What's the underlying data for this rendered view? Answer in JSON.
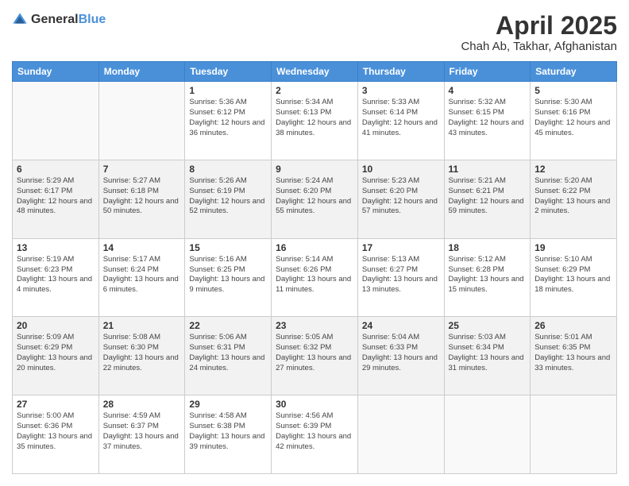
{
  "header": {
    "logo_general": "General",
    "logo_blue": "Blue",
    "month": "April 2025",
    "location": "Chah Ab, Takhar, Afghanistan"
  },
  "days_of_week": [
    "Sunday",
    "Monday",
    "Tuesday",
    "Wednesday",
    "Thursday",
    "Friday",
    "Saturday"
  ],
  "weeks": [
    [
      {
        "day": "",
        "info": ""
      },
      {
        "day": "",
        "info": ""
      },
      {
        "day": "1",
        "info": "Sunrise: 5:36 AM\nSunset: 6:12 PM\nDaylight: 12 hours\nand 36 minutes."
      },
      {
        "day": "2",
        "info": "Sunrise: 5:34 AM\nSunset: 6:13 PM\nDaylight: 12 hours\nand 38 minutes."
      },
      {
        "day": "3",
        "info": "Sunrise: 5:33 AM\nSunset: 6:14 PM\nDaylight: 12 hours\nand 41 minutes."
      },
      {
        "day": "4",
        "info": "Sunrise: 5:32 AM\nSunset: 6:15 PM\nDaylight: 12 hours\nand 43 minutes."
      },
      {
        "day": "5",
        "info": "Sunrise: 5:30 AM\nSunset: 6:16 PM\nDaylight: 12 hours\nand 45 minutes."
      }
    ],
    [
      {
        "day": "6",
        "info": "Sunrise: 5:29 AM\nSunset: 6:17 PM\nDaylight: 12 hours\nand 48 minutes."
      },
      {
        "day": "7",
        "info": "Sunrise: 5:27 AM\nSunset: 6:18 PM\nDaylight: 12 hours\nand 50 minutes."
      },
      {
        "day": "8",
        "info": "Sunrise: 5:26 AM\nSunset: 6:19 PM\nDaylight: 12 hours\nand 52 minutes."
      },
      {
        "day": "9",
        "info": "Sunrise: 5:24 AM\nSunset: 6:20 PM\nDaylight: 12 hours\nand 55 minutes."
      },
      {
        "day": "10",
        "info": "Sunrise: 5:23 AM\nSunset: 6:20 PM\nDaylight: 12 hours\nand 57 minutes."
      },
      {
        "day": "11",
        "info": "Sunrise: 5:21 AM\nSunset: 6:21 PM\nDaylight: 12 hours\nand 59 minutes."
      },
      {
        "day": "12",
        "info": "Sunrise: 5:20 AM\nSunset: 6:22 PM\nDaylight: 13 hours\nand 2 minutes."
      }
    ],
    [
      {
        "day": "13",
        "info": "Sunrise: 5:19 AM\nSunset: 6:23 PM\nDaylight: 13 hours\nand 4 minutes."
      },
      {
        "day": "14",
        "info": "Sunrise: 5:17 AM\nSunset: 6:24 PM\nDaylight: 13 hours\nand 6 minutes."
      },
      {
        "day": "15",
        "info": "Sunrise: 5:16 AM\nSunset: 6:25 PM\nDaylight: 13 hours\nand 9 minutes."
      },
      {
        "day": "16",
        "info": "Sunrise: 5:14 AM\nSunset: 6:26 PM\nDaylight: 13 hours\nand 11 minutes."
      },
      {
        "day": "17",
        "info": "Sunrise: 5:13 AM\nSunset: 6:27 PM\nDaylight: 13 hours\nand 13 minutes."
      },
      {
        "day": "18",
        "info": "Sunrise: 5:12 AM\nSunset: 6:28 PM\nDaylight: 13 hours\nand 15 minutes."
      },
      {
        "day": "19",
        "info": "Sunrise: 5:10 AM\nSunset: 6:29 PM\nDaylight: 13 hours\nand 18 minutes."
      }
    ],
    [
      {
        "day": "20",
        "info": "Sunrise: 5:09 AM\nSunset: 6:29 PM\nDaylight: 13 hours\nand 20 minutes."
      },
      {
        "day": "21",
        "info": "Sunrise: 5:08 AM\nSunset: 6:30 PM\nDaylight: 13 hours\nand 22 minutes."
      },
      {
        "day": "22",
        "info": "Sunrise: 5:06 AM\nSunset: 6:31 PM\nDaylight: 13 hours\nand 24 minutes."
      },
      {
        "day": "23",
        "info": "Sunrise: 5:05 AM\nSunset: 6:32 PM\nDaylight: 13 hours\nand 27 minutes."
      },
      {
        "day": "24",
        "info": "Sunrise: 5:04 AM\nSunset: 6:33 PM\nDaylight: 13 hours\nand 29 minutes."
      },
      {
        "day": "25",
        "info": "Sunrise: 5:03 AM\nSunset: 6:34 PM\nDaylight: 13 hours\nand 31 minutes."
      },
      {
        "day": "26",
        "info": "Sunrise: 5:01 AM\nSunset: 6:35 PM\nDaylight: 13 hours\nand 33 minutes."
      }
    ],
    [
      {
        "day": "27",
        "info": "Sunrise: 5:00 AM\nSunset: 6:36 PM\nDaylight: 13 hours\nand 35 minutes."
      },
      {
        "day": "28",
        "info": "Sunrise: 4:59 AM\nSunset: 6:37 PM\nDaylight: 13 hours\nand 37 minutes."
      },
      {
        "day": "29",
        "info": "Sunrise: 4:58 AM\nSunset: 6:38 PM\nDaylight: 13 hours\nand 39 minutes."
      },
      {
        "day": "30",
        "info": "Sunrise: 4:56 AM\nSunset: 6:39 PM\nDaylight: 13 hours\nand 42 minutes."
      },
      {
        "day": "",
        "info": ""
      },
      {
        "day": "",
        "info": ""
      },
      {
        "day": "",
        "info": ""
      }
    ]
  ]
}
